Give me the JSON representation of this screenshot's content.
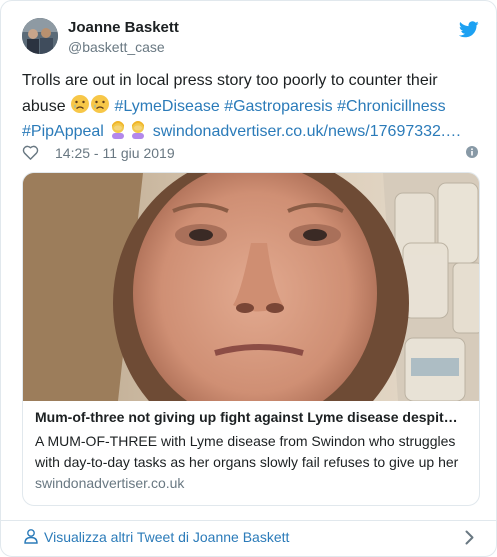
{
  "user": {
    "name": "Joanne Baskett",
    "handle": "@baskett_case"
  },
  "tweet": {
    "text_before": "Trolls are out in local press story too poorly to counter their abuse ",
    "hashtags": [
      "#LymeDisease",
      "#Gastroparesis",
      "#Chronicillness",
      "#PipAppeal"
    ],
    "url": "swindonadvertiser.co.uk/news/17697332.…"
  },
  "meta": {
    "timestamp": "14:25 - 11 giu 2019"
  },
  "link_card": {
    "title": "Mum-of-three not giving up fight against Lyme disease despit…",
    "description": "A MUM-OF-THREE with Lyme disease from Swindon who struggles with day-to-day tasks as her organs slowly fail refuses to give up her",
    "domain": "swindonadvertiser.co.uk"
  },
  "footer": {
    "more_label": "Visualizza altri Tweet di Joanne Baskett"
  },
  "colors": {
    "link": "#2b7bb9",
    "muted": "#697882",
    "border": "#e1e8ed",
    "bird": "#1da1f2"
  },
  "icons": [
    "twitter-bird-icon",
    "heart-icon",
    "info-icon",
    "person-icon",
    "chevron-right-icon",
    "crying-face-emoji",
    "woman-facepalming-emoji"
  ]
}
